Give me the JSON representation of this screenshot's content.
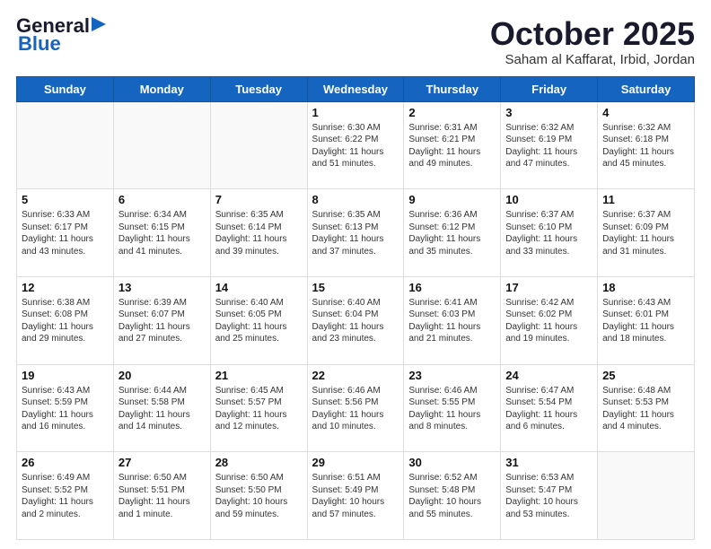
{
  "header": {
    "logo_general": "General",
    "logo_blue": "Blue",
    "month_title": "October 2025",
    "location": "Saham al Kaffarat, Irbid, Jordan"
  },
  "weekdays": [
    "Sunday",
    "Monday",
    "Tuesday",
    "Wednesday",
    "Thursday",
    "Friday",
    "Saturday"
  ],
  "weeks": [
    [
      {
        "day": "",
        "text": ""
      },
      {
        "day": "",
        "text": ""
      },
      {
        "day": "",
        "text": ""
      },
      {
        "day": "1",
        "text": "Sunrise: 6:30 AM\nSunset: 6:22 PM\nDaylight: 11 hours and 51 minutes."
      },
      {
        "day": "2",
        "text": "Sunrise: 6:31 AM\nSunset: 6:21 PM\nDaylight: 11 hours and 49 minutes."
      },
      {
        "day": "3",
        "text": "Sunrise: 6:32 AM\nSunset: 6:19 PM\nDaylight: 11 hours and 47 minutes."
      },
      {
        "day": "4",
        "text": "Sunrise: 6:32 AM\nSunset: 6:18 PM\nDaylight: 11 hours and 45 minutes."
      }
    ],
    [
      {
        "day": "5",
        "text": "Sunrise: 6:33 AM\nSunset: 6:17 PM\nDaylight: 11 hours and 43 minutes."
      },
      {
        "day": "6",
        "text": "Sunrise: 6:34 AM\nSunset: 6:15 PM\nDaylight: 11 hours and 41 minutes."
      },
      {
        "day": "7",
        "text": "Sunrise: 6:35 AM\nSunset: 6:14 PM\nDaylight: 11 hours and 39 minutes."
      },
      {
        "day": "8",
        "text": "Sunrise: 6:35 AM\nSunset: 6:13 PM\nDaylight: 11 hours and 37 minutes."
      },
      {
        "day": "9",
        "text": "Sunrise: 6:36 AM\nSunset: 6:12 PM\nDaylight: 11 hours and 35 minutes."
      },
      {
        "day": "10",
        "text": "Sunrise: 6:37 AM\nSunset: 6:10 PM\nDaylight: 11 hours and 33 minutes."
      },
      {
        "day": "11",
        "text": "Sunrise: 6:37 AM\nSunset: 6:09 PM\nDaylight: 11 hours and 31 minutes."
      }
    ],
    [
      {
        "day": "12",
        "text": "Sunrise: 6:38 AM\nSunset: 6:08 PM\nDaylight: 11 hours and 29 minutes."
      },
      {
        "day": "13",
        "text": "Sunrise: 6:39 AM\nSunset: 6:07 PM\nDaylight: 11 hours and 27 minutes."
      },
      {
        "day": "14",
        "text": "Sunrise: 6:40 AM\nSunset: 6:05 PM\nDaylight: 11 hours and 25 minutes."
      },
      {
        "day": "15",
        "text": "Sunrise: 6:40 AM\nSunset: 6:04 PM\nDaylight: 11 hours and 23 minutes."
      },
      {
        "day": "16",
        "text": "Sunrise: 6:41 AM\nSunset: 6:03 PM\nDaylight: 11 hours and 21 minutes."
      },
      {
        "day": "17",
        "text": "Sunrise: 6:42 AM\nSunset: 6:02 PM\nDaylight: 11 hours and 19 minutes."
      },
      {
        "day": "18",
        "text": "Sunrise: 6:43 AM\nSunset: 6:01 PM\nDaylight: 11 hours and 18 minutes."
      }
    ],
    [
      {
        "day": "19",
        "text": "Sunrise: 6:43 AM\nSunset: 5:59 PM\nDaylight: 11 hours and 16 minutes."
      },
      {
        "day": "20",
        "text": "Sunrise: 6:44 AM\nSunset: 5:58 PM\nDaylight: 11 hours and 14 minutes."
      },
      {
        "day": "21",
        "text": "Sunrise: 6:45 AM\nSunset: 5:57 PM\nDaylight: 11 hours and 12 minutes."
      },
      {
        "day": "22",
        "text": "Sunrise: 6:46 AM\nSunset: 5:56 PM\nDaylight: 11 hours and 10 minutes."
      },
      {
        "day": "23",
        "text": "Sunrise: 6:46 AM\nSunset: 5:55 PM\nDaylight: 11 hours and 8 minutes."
      },
      {
        "day": "24",
        "text": "Sunrise: 6:47 AM\nSunset: 5:54 PM\nDaylight: 11 hours and 6 minutes."
      },
      {
        "day": "25",
        "text": "Sunrise: 6:48 AM\nSunset: 5:53 PM\nDaylight: 11 hours and 4 minutes."
      }
    ],
    [
      {
        "day": "26",
        "text": "Sunrise: 6:49 AM\nSunset: 5:52 PM\nDaylight: 11 hours and 2 minutes."
      },
      {
        "day": "27",
        "text": "Sunrise: 6:50 AM\nSunset: 5:51 PM\nDaylight: 11 hours and 1 minute."
      },
      {
        "day": "28",
        "text": "Sunrise: 6:50 AM\nSunset: 5:50 PM\nDaylight: 10 hours and 59 minutes."
      },
      {
        "day": "29",
        "text": "Sunrise: 6:51 AM\nSunset: 5:49 PM\nDaylight: 10 hours and 57 minutes."
      },
      {
        "day": "30",
        "text": "Sunrise: 6:52 AM\nSunset: 5:48 PM\nDaylight: 10 hours and 55 minutes."
      },
      {
        "day": "31",
        "text": "Sunrise: 6:53 AM\nSunset: 5:47 PM\nDaylight: 10 hours and 53 minutes."
      },
      {
        "day": "",
        "text": ""
      }
    ]
  ]
}
